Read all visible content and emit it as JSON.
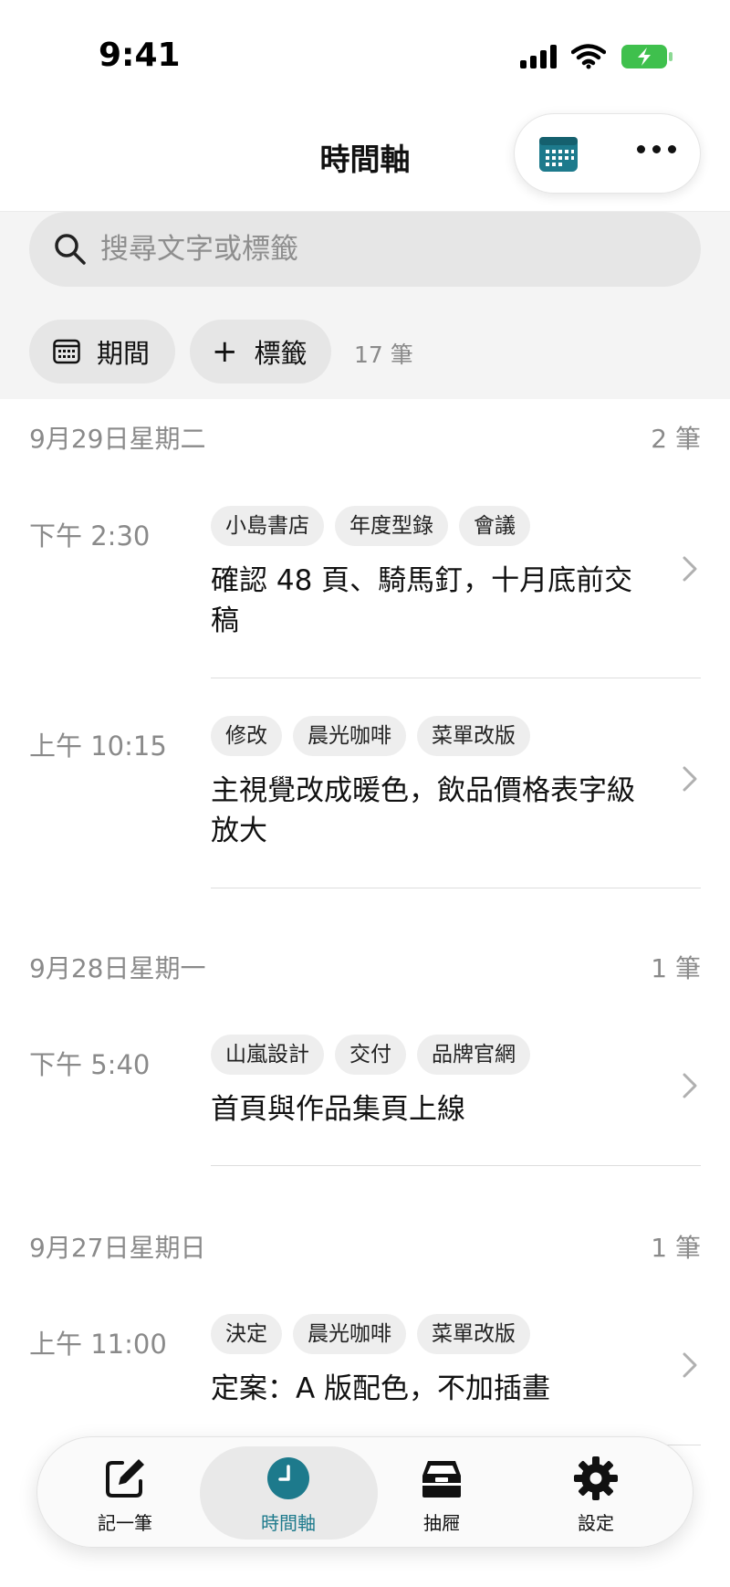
{
  "status_bar": {
    "time": "9:41"
  },
  "header": {
    "title": "時間軸"
  },
  "search": {
    "placeholder": "搜尋文字或標籤"
  },
  "filters": {
    "period_label": "期間",
    "tag_label": "標籤",
    "total_count": "17 筆"
  },
  "days": [
    {
      "date": "9月29日星期二",
      "count": "2 筆",
      "entries": [
        {
          "time": "下午 2:30",
          "tags": [
            "小島書店",
            "年度型錄",
            "會議"
          ],
          "text": "確認 48 頁、騎馬釘，十月底前交稿"
        },
        {
          "time": "上午 10:15",
          "tags": [
            "修改",
            "晨光咖啡",
            "菜單改版"
          ],
          "text": "主視覺改成暖色，飲品價格表字級放大"
        }
      ]
    },
    {
      "date": "9月28日星期一",
      "count": "1 筆",
      "entries": [
        {
          "time": "下午 5:40",
          "tags": [
            "山嵐設計",
            "交付",
            "品牌官網"
          ],
          "text": "首頁與作品集頁上線"
        }
      ]
    },
    {
      "date": "9月27日星期日",
      "count": "1 筆",
      "entries": [
        {
          "time": "上午 11:00",
          "tags": [
            "決定",
            "晨光咖啡",
            "菜單改版"
          ],
          "text": "定案：A 版配色，不加插畫"
        }
      ]
    }
  ],
  "tabbar": {
    "items": [
      {
        "label": "記一筆",
        "icon": "compose-icon"
      },
      {
        "label": "時間軸",
        "icon": "clock-icon",
        "active": true
      },
      {
        "label": "抽屜",
        "icon": "drawer-icon"
      },
      {
        "label": "設定",
        "icon": "gear-icon"
      }
    ]
  },
  "colors": {
    "accent": "#1d7a8c",
    "battery": "#3fc04d"
  }
}
